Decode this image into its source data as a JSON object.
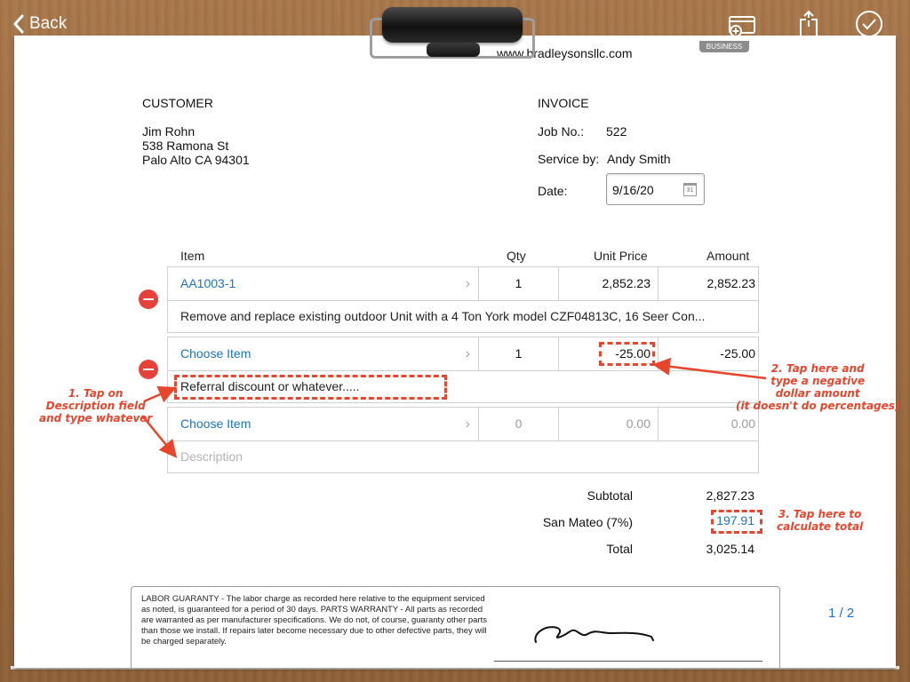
{
  "topbar": {
    "back_label": "Back",
    "icons": [
      "card-plus-icon",
      "share-icon",
      "checkmark-circle-icon"
    ]
  },
  "header": {
    "website": "www.bradleysonsllc.com",
    "badge": "BUSINESS"
  },
  "customer": {
    "heading": "CUSTOMER",
    "name": "Jim Rohn",
    "address1": "538 Ramona St",
    "address2": "Palo Alto CA 94301"
  },
  "invoice": {
    "heading": "INVOICE",
    "job_label": "Job No.:",
    "job_value": "522",
    "service_label": "Service by:",
    "service_value": "Andy Smith",
    "date_label": "Date:",
    "date_value": "9/16/20",
    "calendar_day": "31"
  },
  "table": {
    "headers": {
      "item": "Item",
      "qty": "Qty",
      "unit": "Unit Price",
      "amount": "Amount"
    },
    "rows": [
      {
        "item": "AA1003-1",
        "qty": "1",
        "unit": "2,852.23",
        "amount": "2,852.23",
        "description": "Remove and replace existing outdoor Unit with a 4 Ton York model CZF04813C, 16 Seer Con..."
      },
      {
        "item": "Choose Item",
        "qty": "1",
        "unit": "-25.00",
        "amount": "-25.00",
        "description": "Referral discount or whatever....."
      },
      {
        "item": "Choose Item",
        "qty": "0",
        "unit": "0.00",
        "amount": "0.00",
        "description_placeholder": "Description"
      }
    ]
  },
  "totals": {
    "subtotal_label": "Subtotal",
    "subtotal_value": "2,827.23",
    "tax_label": "San Mateo (7%)",
    "tax_value": "197.91",
    "total_label": "Total",
    "total_value": "3,025.14"
  },
  "warranty": {
    "text": "LABOR GUARANTY - The labor charge as recorded here relative to the equipment serviced as noted, is guaranteed for a period of 30 days. PARTS WARRANTY - All parts as recorded are warranted as per manufacturer specifications. We do not, of course, guaranty other parts than those we install. If repairs later become necessary due to other defective parts, they will be charged separately."
  },
  "page_indicator": "1 / 2",
  "annotations": {
    "one": [
      "1. Tap on",
      "Description field",
      "and type whatever"
    ],
    "two": [
      "2. Tap here and",
      "type a negative",
      "dollar amount",
      "(it doesn't do percentages)"
    ],
    "three": [
      "3. Tap here to",
      "calculate total"
    ]
  },
  "colors": {
    "link": "#1a73c8",
    "delete": "#e8403a",
    "annotation": "#e8452d",
    "wood": "#9a6a3f"
  }
}
